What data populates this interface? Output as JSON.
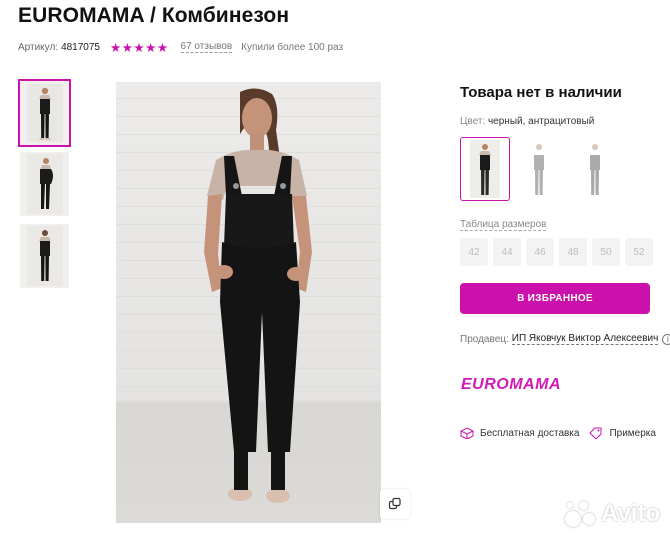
{
  "product": {
    "title": "EUROMAMA / Комбинезон",
    "article_label": "Артикул:",
    "article_value": "4817075",
    "rating_stars": "★★★★★",
    "rating_value": 5,
    "reviews": "67 отзывов",
    "purchased": "Купили более 100 раз"
  },
  "availability": {
    "status": "Товара нет в наличии",
    "color_label": "Цвет:",
    "color_value": "черный, антрацитовый"
  },
  "sizes": {
    "label": "Таблица размеров",
    "options": [
      "42",
      "44",
      "46",
      "48",
      "50",
      "52"
    ]
  },
  "actions": {
    "favorite_label": "В ИЗБРАННОЕ"
  },
  "seller": {
    "label": "Продавец:",
    "name": "ИП Яковчук Виктор Алексеевич",
    "info_icon": "i"
  },
  "brand": {
    "logo_text": "EUROMAMA"
  },
  "features": [
    {
      "label": "Бесплатная доставка",
      "icon": "box-icon"
    },
    {
      "label": "Примерка",
      "icon": "tag-icon"
    }
  ],
  "watermark": {
    "text": "Avito"
  },
  "colors": {
    "accent": "#cb11ab",
    "logo": "#d21ab6",
    "stars": "#cb11ab"
  }
}
